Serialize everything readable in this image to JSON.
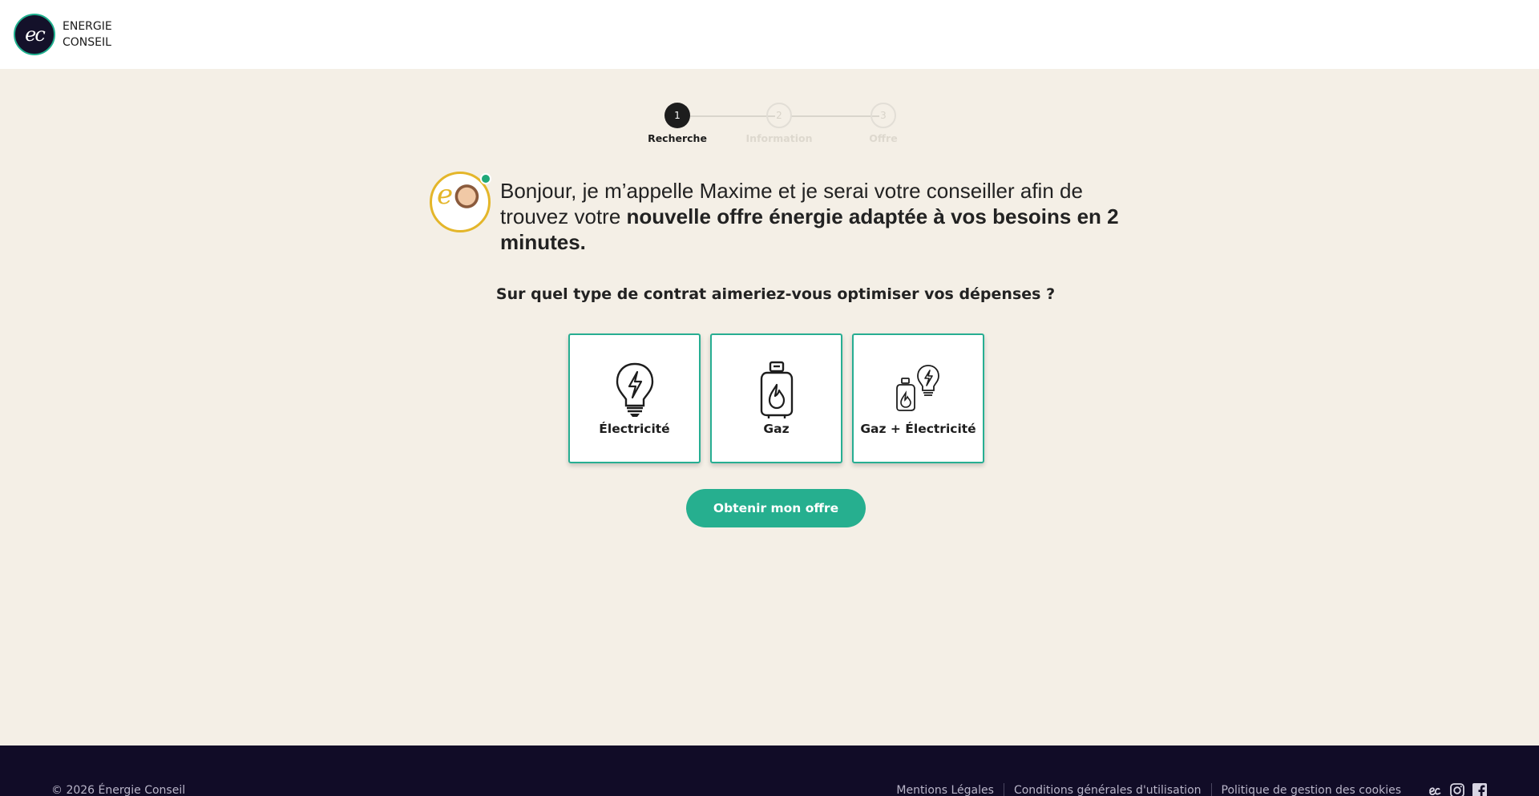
{
  "header": {
    "logo_initials": "ec",
    "logo_text_line1": "ENERGIE",
    "logo_text_line2": "CONSEIL"
  },
  "stepper": {
    "steps": [
      {
        "number": "1",
        "label": "Recherche",
        "active": true
      },
      {
        "number": "2",
        "label": "Information",
        "active": false
      },
      {
        "number": "3",
        "label": "Offre",
        "active": false
      }
    ]
  },
  "intro": {
    "avatar_letter": "e",
    "text_regular": "Bonjour, je m’appelle Maxime et je serai votre conseiller afin de trouvez votre ",
    "text_bold": "nouvelle offre énergie adaptée à vos besoins en 2 minutes."
  },
  "question": "Sur quel type de contrat aimeriez-vous optimiser vos dépenses ?",
  "options": [
    {
      "label": "Électricité",
      "icon": "lightbulb-icon"
    },
    {
      "label": "Gaz",
      "icon": "gas-bottle-icon"
    },
    {
      "label": "Gaz + Électricité",
      "icon": "gas-and-lightbulb-icon"
    }
  ],
  "cta_label": "Obtenir mon offre",
  "footer": {
    "copyright": "© 2026 Énergie Conseil",
    "links": [
      "Mentions Légales",
      "Conditions générales d'utilisation",
      "Politique de gestion des cookies"
    ],
    "icons": [
      "ec-logo-icon",
      "instagram-icon",
      "facebook-icon"
    ]
  },
  "colors": {
    "accent": "#26af8f",
    "background": "#f4efe6",
    "footer": "#110c27",
    "dark": "#1d1d1d"
  }
}
